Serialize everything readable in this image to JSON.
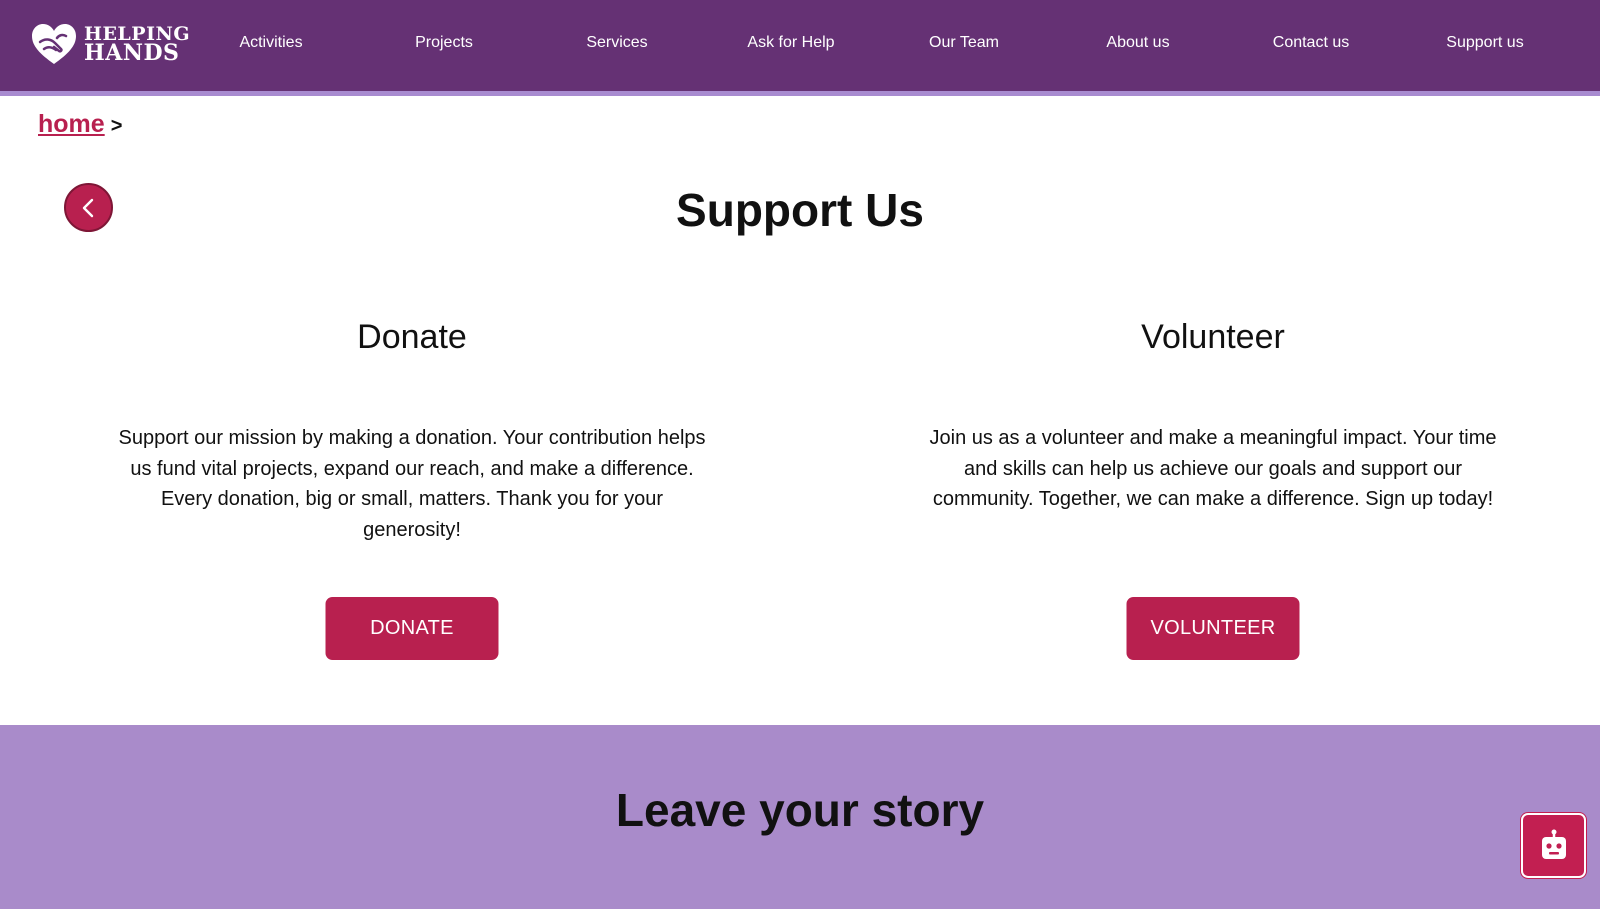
{
  "brand": {
    "line1": "HELPING",
    "line2": "HANDS",
    "logo_icon": "heart-hands-icon"
  },
  "nav": {
    "items": [
      {
        "label": "Activities"
      },
      {
        "label": "Projects"
      },
      {
        "label": "Services"
      },
      {
        "label": "Ask for Help"
      },
      {
        "label": "Our Team"
      },
      {
        "label": "About us"
      },
      {
        "label": "Contact us"
      },
      {
        "label": "Support us"
      }
    ]
  },
  "breadcrumb": {
    "home": "home",
    "separator": ">"
  },
  "back": {
    "icon": "chevron-left-icon"
  },
  "page": {
    "title": "Support Us"
  },
  "donate": {
    "heading": "Donate",
    "text": "Support our mission by making a donation. Your contribution helps us fund vital projects, expand our reach, and make a difference. Every donation, big or small, matters. Thank you for your generosity!",
    "button": "DONATE"
  },
  "volunteer": {
    "heading": "Volunteer",
    "text": "Join us as a volunteer and make a meaningful impact. Your time and skills can help us achieve our goals and support our community. Together, we can make a difference. Sign up today!",
    "button": "VOLUNTEER"
  },
  "story": {
    "title": "Leave your story"
  },
  "chatbot": {
    "icon": "robot-icon"
  },
  "colors": {
    "nav_bg": "#653174",
    "nav_underline": "#a88bd0",
    "accent": "#b8204f",
    "story_bg": "#a98bca"
  }
}
